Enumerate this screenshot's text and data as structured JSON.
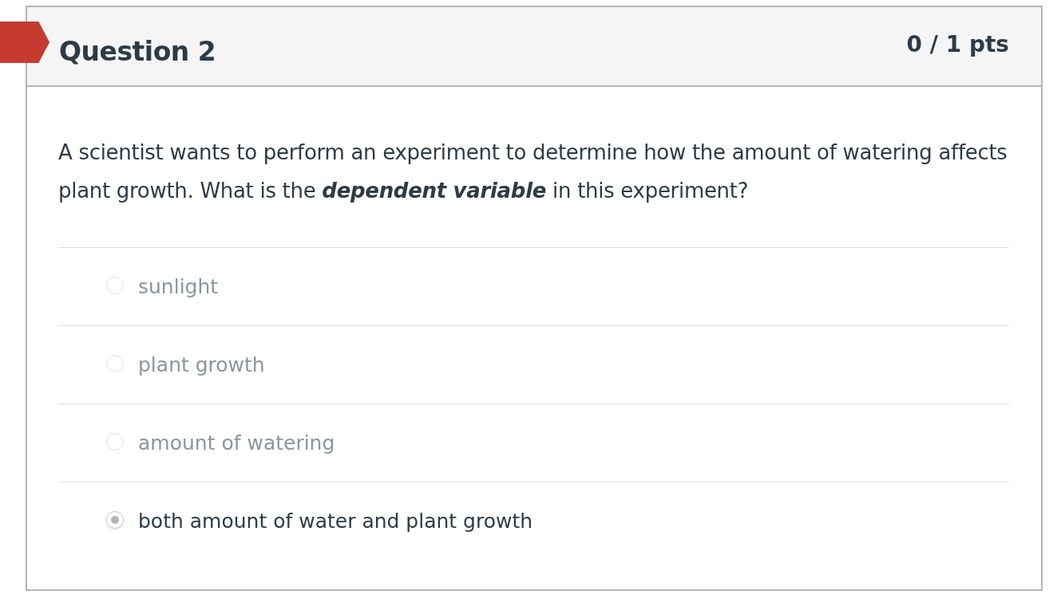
{
  "question": {
    "title": "Question 2",
    "points": "0 / 1 pts",
    "flagged": true,
    "text": "A scientist wants to perform an experiment to determine how the amount of watering affects plant growth.  What is the **dependent variable** in this experiment?",
    "answers": [
      {
        "label": "sunlight",
        "selected": false
      },
      {
        "label": "plant growth",
        "selected": false
      },
      {
        "label": "amount of watering",
        "selected": false
      },
      {
        "label": "both amount of water and plant growth",
        "selected": true
      }
    ]
  }
}
